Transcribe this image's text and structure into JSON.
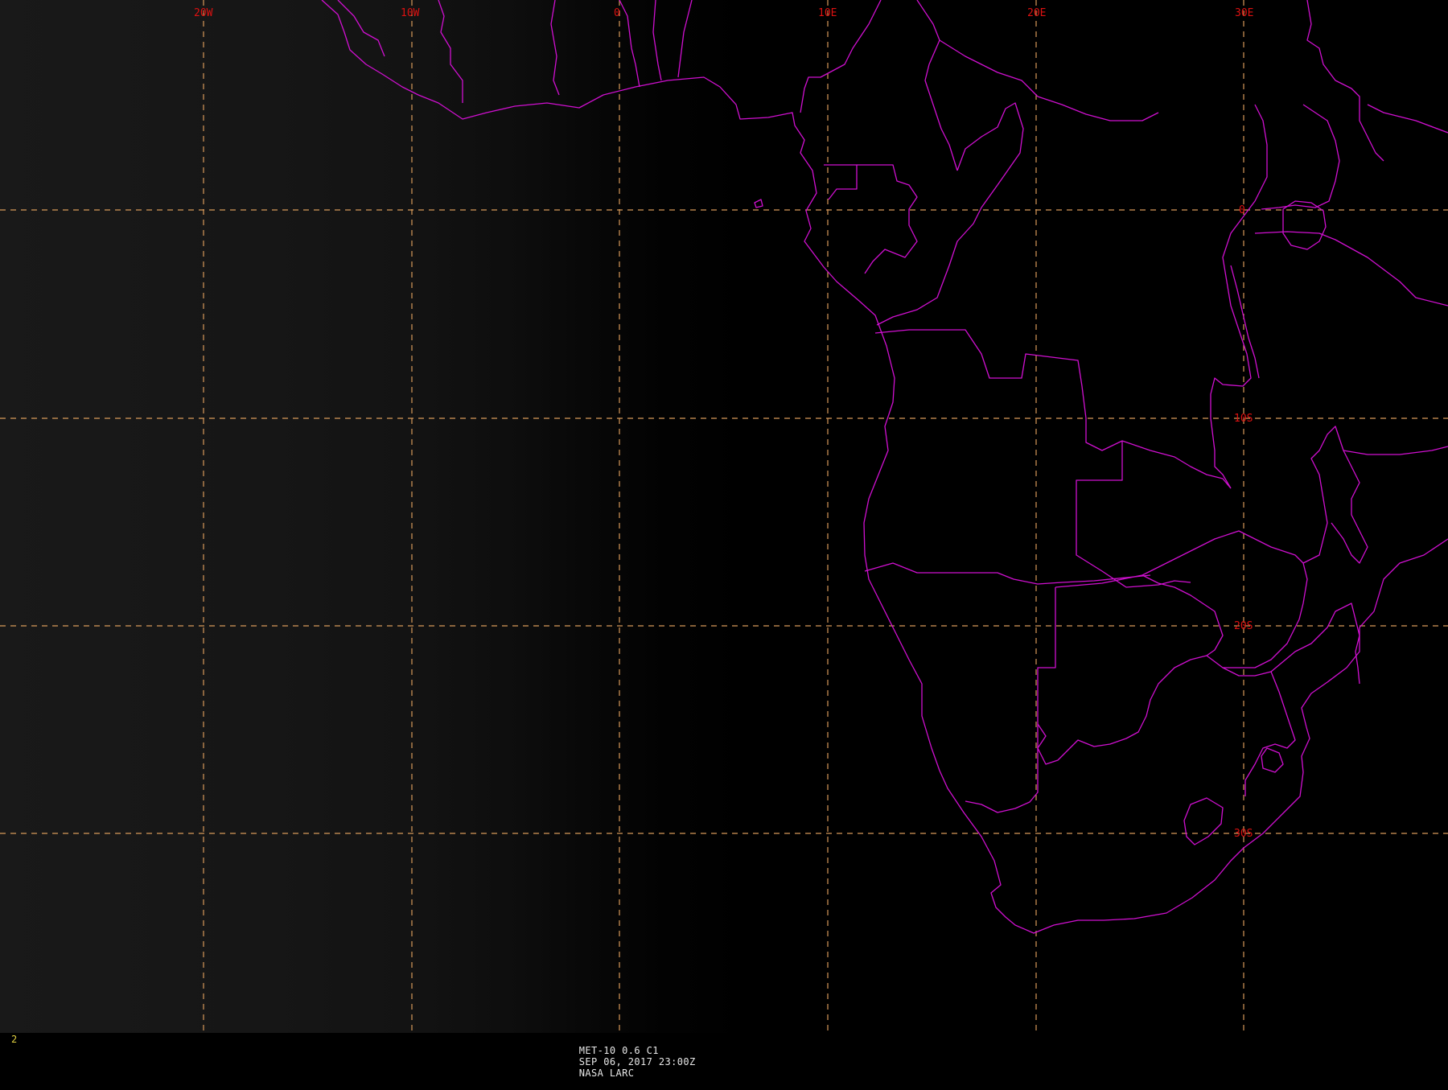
{
  "map": {
    "background": "#000000",
    "grid_color": "#d89a5a",
    "boundary_color": "#d010d0",
    "label_color": "#dd1111",
    "longitude_labels": [
      "20W",
      "10W",
      "0",
      "10E",
      "20E",
      "30E"
    ],
    "latitude_labels": [
      "0",
      "10S",
      "20S",
      "30S"
    ]
  },
  "status": {
    "frame_number": "2",
    "satellite": "MET-10 0.6 C1",
    "datetime": "SEP 06, 2017 23:00Z",
    "source": "NASA LARC"
  }
}
